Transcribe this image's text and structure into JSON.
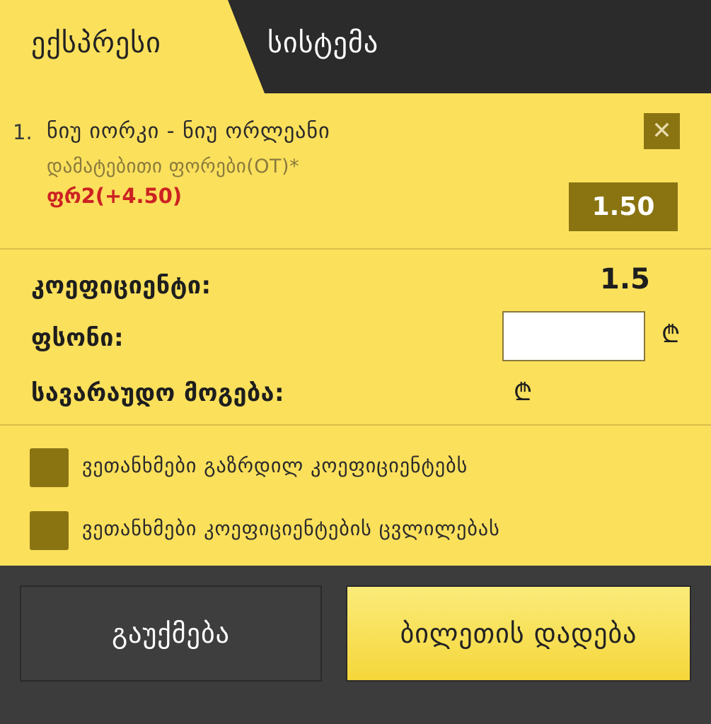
{
  "tabs": {
    "express": "ექსპრესი",
    "system": "სისტემა"
  },
  "bet": {
    "index": "1.",
    "match": "ნიუ იორკი - ნიუ ორლეანი",
    "market": "დამატებითი ფორები(OT)*",
    "outcome": "ფრ2(+4.50)",
    "odds": "1.50"
  },
  "summary": {
    "coef_label": "კოეფიციენტი:",
    "coef_value": "1.5",
    "stake_label": "ფსონი:",
    "stake_value": "",
    "potential_label": "სავარაუდო მოგება:",
    "currency_symbol": "₾"
  },
  "options": {
    "accept_increased": "ვეთანხმები გაზრდილ კოეფიციენტებს",
    "accept_changes": "ვეთანხმები კოეფიციენტების ცვლილებას"
  },
  "footer": {
    "cancel": "გაუქმება",
    "place_bet": "ბილეთის დადება"
  },
  "colors": {
    "background": "#fbe05c",
    "dark": "#2a2a2a",
    "accent": "#8a7412",
    "outcome_red": "#cc2222"
  },
  "icons": [
    "close-icon",
    "lari-currency-icon"
  ]
}
